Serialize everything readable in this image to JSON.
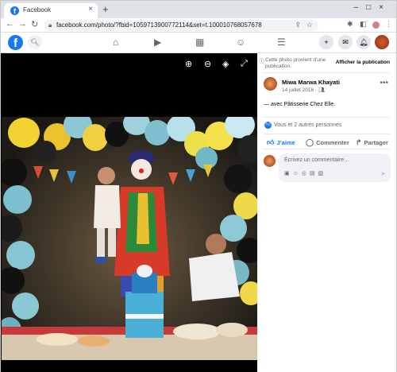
{
  "browser": {
    "tab_title": "Facebook",
    "tab_favicon": "f",
    "url": "facebook.com/photo/?fbid=1059713900772114&set=t.100010768057678",
    "tab_close_icon": "×",
    "new_tab_icon": "+"
  },
  "fb": {
    "logo": "f",
    "nav_icons": [
      "home-icon",
      "watch-icon",
      "marketplace-icon",
      "groups-icon",
      "menu-icon"
    ],
    "right_icons": [
      "create-icon",
      "messenger-icon",
      "notifications-icon"
    ],
    "accent": "#1877f2"
  },
  "viewer": {
    "tools": [
      "zoom-in-icon",
      "zoom-out-icon",
      "tag-icon",
      "fullscreen-icon"
    ]
  },
  "panel": {
    "info_text": "Cette photo provient d’une publication.",
    "see_post": "Afficher la publication",
    "author": "Miwa Marwa Khayati",
    "date": "14 juillet 2016 · ",
    "caption": "— avec Pâtisserie Chez Elle.",
    "reactions": "Vous et 2 autres personnes",
    "actions": {
      "like": "J’aime",
      "comment": "Commenter",
      "share": "Partager"
    },
    "comment_placeholder": "Écrivez un commentaire…"
  }
}
